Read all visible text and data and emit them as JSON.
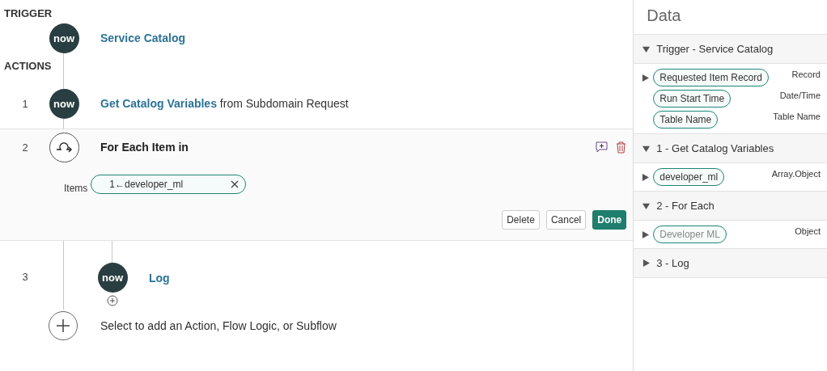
{
  "flow": {
    "trigger_label": "TRIGGER",
    "trigger": {
      "logo": "now",
      "title": "Service Catalog"
    },
    "actions_label": "ACTIONS",
    "steps": [
      {
        "kind": "action",
        "number": "1",
        "logo": "now",
        "title": "Get Catalog Variables",
        "suffix": "from Subdomain Request",
        "nested": false
      },
      {
        "kind": "loop",
        "number": "2",
        "title": "For Each Item in",
        "expanded": true,
        "items_label": "Items",
        "items_value": "1←developer_ml",
        "buttons": [
          {
            "label": "Delete",
            "primary": false
          },
          {
            "label": "Cancel",
            "primary": false
          },
          {
            "label": "Done",
            "primary": true
          }
        ]
      },
      {
        "kind": "action",
        "number": "3",
        "logo": "now",
        "title": "Log",
        "nested": true
      }
    ],
    "add_hint": "Select to add an Action, Flow Logic, or Subflow"
  },
  "data_panel": {
    "title": "Data",
    "sections": [
      {
        "title": "Trigger - Service Catalog",
        "expanded": true,
        "fields": [
          {
            "label": "Requested Item Record",
            "type": "Record",
            "expandable": true,
            "dimmed": false
          },
          {
            "label": "Run Start Time",
            "type": "Date/Time",
            "expandable": false,
            "dimmed": false
          },
          {
            "label": "Table Name",
            "type": "Table Name",
            "expandable": false,
            "dimmed": false
          }
        ]
      },
      {
        "title": "1 - Get Catalog Variables",
        "expanded": true,
        "fields": [
          {
            "label": "developer_ml",
            "type": "Array.Object",
            "expandable": true,
            "dimmed": false
          }
        ]
      },
      {
        "title": "2 - For Each",
        "expanded": true,
        "fields": [
          {
            "label": "Developer ML",
            "type": "Object",
            "expandable": true,
            "dimmed": true
          }
        ]
      },
      {
        "title": "3 - Log",
        "expanded": false
      }
    ]
  }
}
